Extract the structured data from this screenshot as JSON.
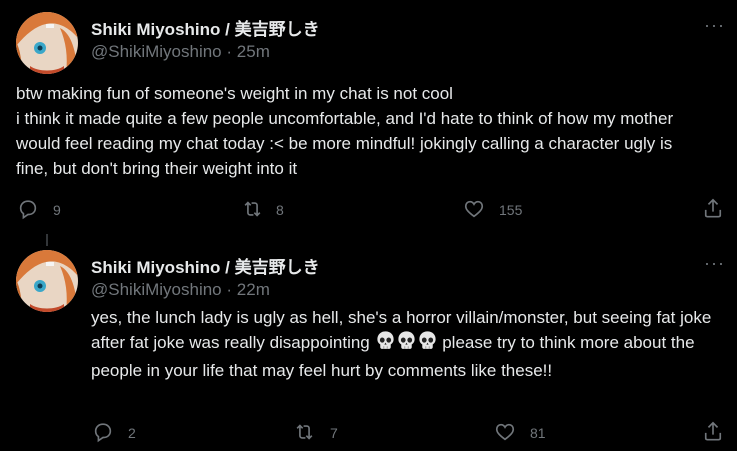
{
  "tweets": [
    {
      "display_name": "Shiki Miyoshino / 美吉野しき",
      "handle": "@ShikiMiyoshino",
      "separator": "·",
      "time": "25m",
      "text": "btw making fun of someone's weight in my chat is not cool\ni think it made quite a few people uncomfortable, and I'd hate to think of how my mother would feel reading my chat today :< be more mindful! jokingly calling a character ugly is fine, but don't bring their weight into it",
      "replies": "9",
      "retweets": "8",
      "likes": "155"
    },
    {
      "display_name": "Shiki Miyoshino / 美吉野しき",
      "handle": "@ShikiMiyoshino",
      "separator": "·",
      "time": "22m",
      "text_before": "yes, the lunch lady is ugly as hell, she's a horror villain/monster, but seeing fat joke after fat joke was really disappointing ",
      "text_after": " please try to think more about the people in your life that may feel hurt by comments like these!!",
      "emoji": "skull",
      "emoji_count": 3,
      "replies": "2",
      "retweets": "7",
      "likes": "81"
    }
  ],
  "more_label": "···",
  "icons": [
    "reply-icon",
    "retweet-icon",
    "like-icon",
    "share-icon",
    "skull-icon"
  ],
  "colors": {
    "background": "#000000",
    "text": "#e7e9ea",
    "muted": "#71767b"
  }
}
